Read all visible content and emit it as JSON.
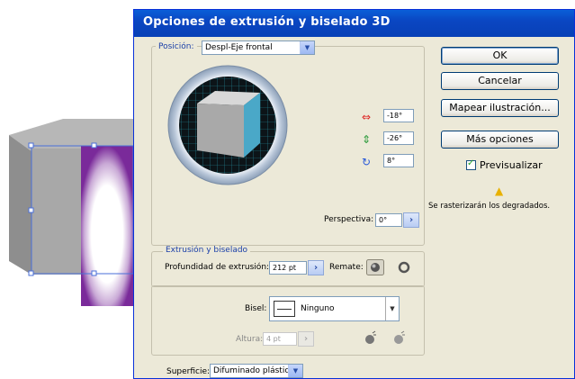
{
  "dialog": {
    "title": "Opciones de extrusión y biselado 3D"
  },
  "position": {
    "legend": "Posición:",
    "preset": "Despl-Eje frontal",
    "rot_x": "-18°",
    "rot_y": "-26°",
    "rot_z": "8°",
    "perspective_label": "Perspectiva:",
    "perspective_value": "0°"
  },
  "extrusion": {
    "legend": "Extrusión y biselado",
    "depth_label": "Profundidad de extrusión:",
    "depth_value": "212 pt",
    "cap_label": "Remate:",
    "bevel_label": "Bisel:",
    "bevel_value": "Ninguno",
    "height_label": "Altura:",
    "height_value": "4 pt"
  },
  "surface": {
    "label": "Superficie:",
    "value": "Difuminado plástico"
  },
  "buttons": {
    "ok": "OK",
    "cancel": "Cancelar",
    "map_art": "Mapear ilustración...",
    "more_options": "Más opciones"
  },
  "preview": {
    "label": "Previsualizar",
    "checked": true
  },
  "warning": {
    "text": "Se rasterizarán los degradados."
  },
  "colors": {
    "cube_front": "#4aa8c8",
    "cube_side": "#a7a7a7",
    "art_purple": "#7a2a9a",
    "title_bar": "#0a4cc4"
  }
}
